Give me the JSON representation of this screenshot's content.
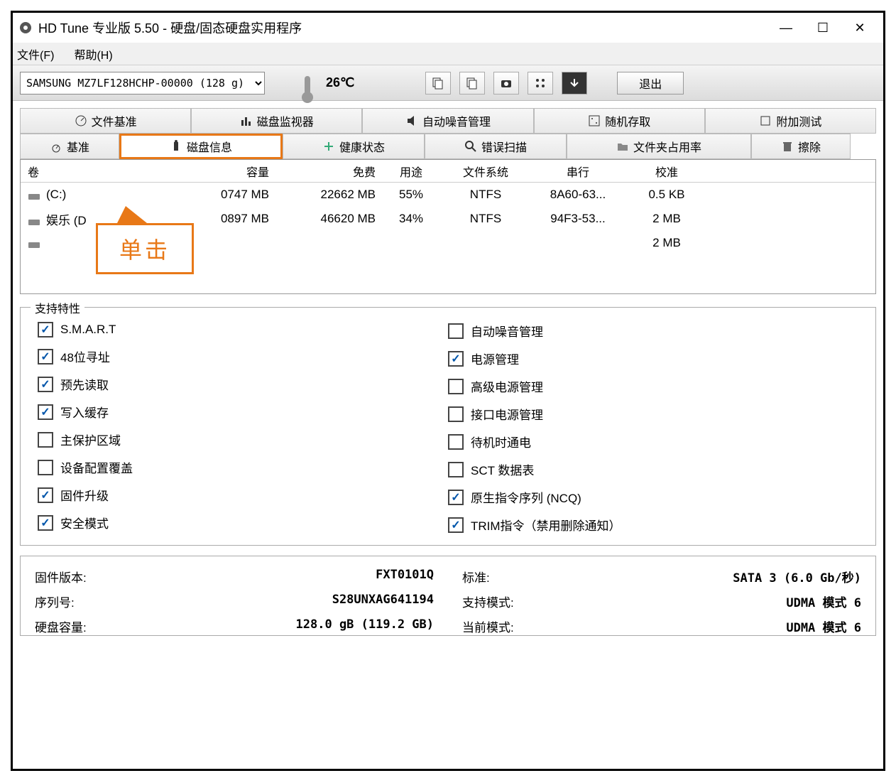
{
  "titlebar": {
    "title": "HD Tune 专业版 5.50 - 硬盘/固态硬盘实用程序"
  },
  "menubar": {
    "file": "文件(F)",
    "help": "帮助(H)"
  },
  "toolbar": {
    "drive_selected": "SAMSUNG MZ7LF128HCHP-00000 (128 g)",
    "temperature": "26℃",
    "exit": "退出"
  },
  "tabs_row1": {
    "file_bench": "文件基准",
    "disk_monitor": "磁盘监视器",
    "aam": "自动噪音管理",
    "random_access": "随机存取",
    "extra_tests": "附加测试"
  },
  "tabs_row2": {
    "benchmark": "基准",
    "info": "磁盘信息",
    "health": "健康状态",
    "error_scan": "错误扫描",
    "folder_usage": "文件夹占用率",
    "erase": "擦除"
  },
  "callout": {
    "text": "单击"
  },
  "vol_headers": {
    "volume": "卷",
    "capacity": "容量",
    "free": "免费",
    "usage": "用途",
    "fs": "文件系统",
    "serial": "串行",
    "cluster": "校准"
  },
  "volumes": [
    {
      "label": "(C:)",
      "capacity": "0747 MB",
      "free": "22662 MB",
      "usage": "55%",
      "fs": "NTFS",
      "serial": "8A60-63...",
      "cluster": "0.5 KB"
    },
    {
      "label": "娱乐 (D",
      "capacity": "0897 MB",
      "free": "46620 MB",
      "usage": "34%",
      "fs": "NTFS",
      "serial": "94F3-53...",
      "cluster": "2 MB"
    },
    {
      "label": "",
      "capacity": "",
      "free": "",
      "usage": "",
      "fs": "",
      "serial": "",
      "cluster": "2 MB"
    }
  ],
  "features_legend": "支持特性",
  "features_left": [
    {
      "label": "S.M.A.R.T",
      "checked": true
    },
    {
      "label": "48位寻址",
      "checked": true
    },
    {
      "label": "预先读取",
      "checked": true
    },
    {
      "label": "写入缓存",
      "checked": true
    },
    {
      "label": "主保护区域",
      "checked": false
    },
    {
      "label": "设备配置覆盖",
      "checked": false
    },
    {
      "label": "固件升级",
      "checked": true
    },
    {
      "label": "安全模式",
      "checked": true
    }
  ],
  "features_right": [
    {
      "label": "自动噪音管理",
      "checked": false
    },
    {
      "label": "电源管理",
      "checked": true
    },
    {
      "label": "高级电源管理",
      "checked": false
    },
    {
      "label": "接口电源管理",
      "checked": false
    },
    {
      "label": "待机时通电",
      "checked": false
    },
    {
      "label": "SCT 数据表",
      "checked": false
    },
    {
      "label": "原生指令序列 (NCQ)",
      "checked": true
    },
    {
      "label": "TRIM指令（禁用删除通知）",
      "checked": true
    }
  ],
  "details_left": [
    {
      "label": "固件版本:",
      "value": "FXT0101Q"
    },
    {
      "label": "序列号:",
      "value": "S28UNXAG641194"
    },
    {
      "label": "硬盘容量:",
      "value": "128.0 gB (119.2 GB)"
    }
  ],
  "details_right": [
    {
      "label": "标准:",
      "value": "SATA 3 (6.0 Gb/秒)"
    },
    {
      "label": "支持模式:",
      "value": "UDMA 模式 6"
    },
    {
      "label": "当前模式:",
      "value": "UDMA 模式 6"
    }
  ]
}
